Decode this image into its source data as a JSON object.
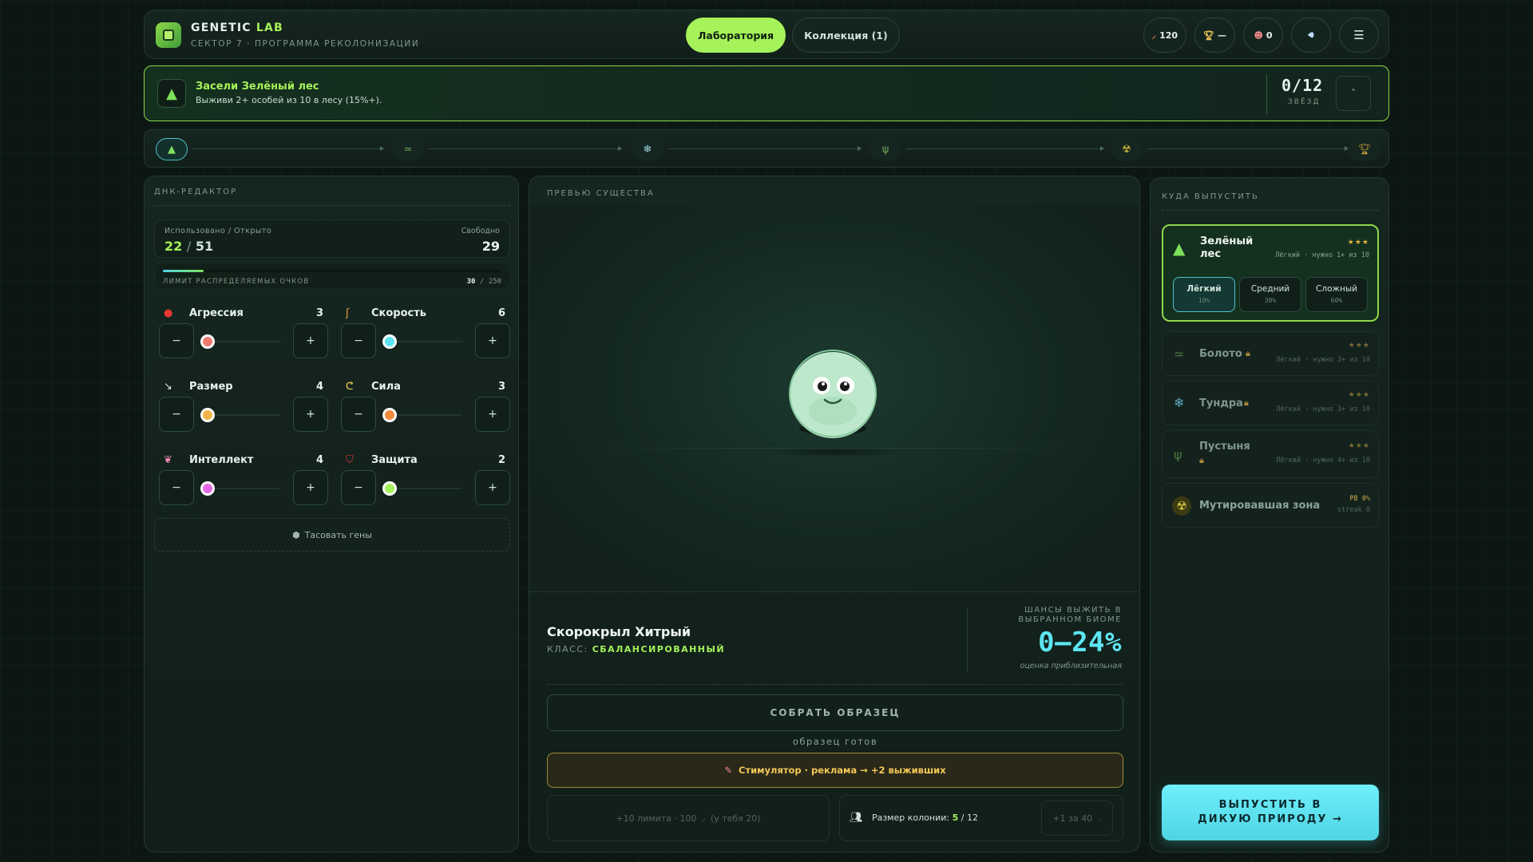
{
  "header": {
    "brand_main": "GENETIC",
    "brand_accent": "LAB",
    "subtitle": "СЕКТОР 7 · ПРОГРАММА РЕКОЛОНИЗАЦИИ",
    "tabs": [
      {
        "label": "Лаборатория",
        "active": true
      },
      {
        "label": "Коллекция (1)",
        "active": false
      }
    ],
    "hud": {
      "currency": "120",
      "trophies": "—",
      "pets": "0"
    },
    "icons": [
      "leaf-currency-icon",
      "trophy-icon",
      "pet-icon",
      "sound-icon",
      "menu-icon"
    ]
  },
  "quest": {
    "title": "Засели Зелёный лес",
    "description": "Выживи 2+ особей из 10 в лесу (15%+).",
    "stars": "0/12",
    "stars_label": "ЗВЁЗД",
    "collapse": "˄"
  },
  "track": {
    "nodes": [
      {
        "icon": "▲",
        "name": "forest",
        "active": true
      },
      {
        "icon": "≃",
        "name": "swamp"
      },
      {
        "icon": "❄",
        "name": "tundra"
      },
      {
        "icon": "ψ",
        "name": "desert"
      },
      {
        "icon": "☢",
        "name": "mutated-zone"
      },
      {
        "icon": "🏆",
        "name": "trophy"
      }
    ]
  },
  "dna": {
    "title": "ДНК-РЕДАКТОР",
    "used_label": "Использовано / Открыто",
    "used": "22",
    "sep": "/",
    "opened": "51",
    "free_label": "Свободно",
    "free": "29",
    "limit_label": "ЛИМИТ РАСПРЕДЕЛЯЕМЫХ ОЧКОВ",
    "limit_used": "30",
    "limit_sep": "/",
    "limit_max": "250",
    "limit_fraction": 0.12,
    "stats": [
      {
        "label": "Агрессия",
        "value": "3",
        "color": "#e53935",
        "knob": "#f07a6e",
        "icon": "●",
        "level": 0.0
      },
      {
        "label": "Скорость",
        "value": "6",
        "color": "#f2a23a",
        "knob": "#5de6f2",
        "icon": "ʃ",
        "level": 0.0
      },
      {
        "label": "Размер",
        "value": "4",
        "color": "#e6e6e6",
        "knob": "#f2b44a",
        "icon": "↘",
        "level": 0.0
      },
      {
        "label": "Сила",
        "value": "3",
        "color": "#f2c857",
        "knob": "#f28a3a",
        "icon": "ᕦ",
        "level": 0.0
      },
      {
        "label": "Интеллект",
        "value": "4",
        "color": "#f08ab8",
        "knob": "#e36ae6",
        "icon": "❦",
        "level": 0.0
      },
      {
        "label": "Защита",
        "value": "2",
        "color": "#e53935",
        "knob": "#a6f25a",
        "icon": "⛉",
        "level": 0.0
      }
    ],
    "minus": "−",
    "plus": "+",
    "shuffle": "Тасовать гены",
    "shuffle_icon": "⬢"
  },
  "preview": {
    "title": "ПРЕВЬЮ СУЩЕСТВА",
    "creature_name": "Скорокрыл Хитрый",
    "class_label": "КЛАСС:",
    "class_value": "СБАЛАНСИРОВАННЫЙ",
    "chance_label": "ШАНСЫ ВЫЖИТЬ В ВЫБРАННОМ БИОМЕ",
    "chance": "0–24%",
    "chance_note": "оценка приблизительная",
    "collect_button": "СОБРАТЬ ОБРАЗЕЦ",
    "ready_text": "образец готов",
    "stim_button": "Стимулятор · реклама → +2 выживших",
    "limit_box_a": "+10 лимита · 100",
    "limit_box_b": "(у тебя 20)",
    "colony_label": "Размер колонии:",
    "colony_current": "5",
    "colony_sep": "/",
    "colony_max": "12",
    "colony_buy": "+1 за 40"
  },
  "release": {
    "title": "КУДА ВЫПУСТИТЬ",
    "biomes": [
      {
        "name": "Зелёный лес",
        "meta": "Лёгкий · нужно 1+ из 10",
        "stars": "★★★",
        "locked": false,
        "selected": true,
        "icon": "▲",
        "color": "#7ee05a"
      },
      {
        "name": "Болото",
        "meta": "Лёгкий · нужно 3+ из 10",
        "stars": "★★★",
        "locked": true,
        "icon": "≃",
        "color": "#7ee05a"
      },
      {
        "name": "Тундра",
        "meta": "Лёгкий · нужно 3+ из 10",
        "stars": "★★★",
        "locked": true,
        "icon": "❄",
        "color": "#5de6f2"
      },
      {
        "name": "Пустыня",
        "meta": "Лёгкий · нужно 4+ из 10",
        "stars": "★★★",
        "locked": true,
        "icon": "ψ",
        "color": "#7ee05a"
      },
      {
        "name": "Мутировавшая зона",
        "meta1": "PB 0%",
        "meta2": "streak 0",
        "locked": false,
        "icon": "☢",
        "color": "#d4c73a"
      }
    ],
    "difficulties": [
      {
        "label": "Лёгкий",
        "pct": "10%",
        "selected": true
      },
      {
        "label": "Средний",
        "pct": "30%",
        "selected": false
      },
      {
        "label": "Сложный",
        "pct": "60%",
        "selected": false
      }
    ],
    "release_button": "ВЫПУСТИТЬ В ДИКУЮ ПРИРОДУ →"
  }
}
